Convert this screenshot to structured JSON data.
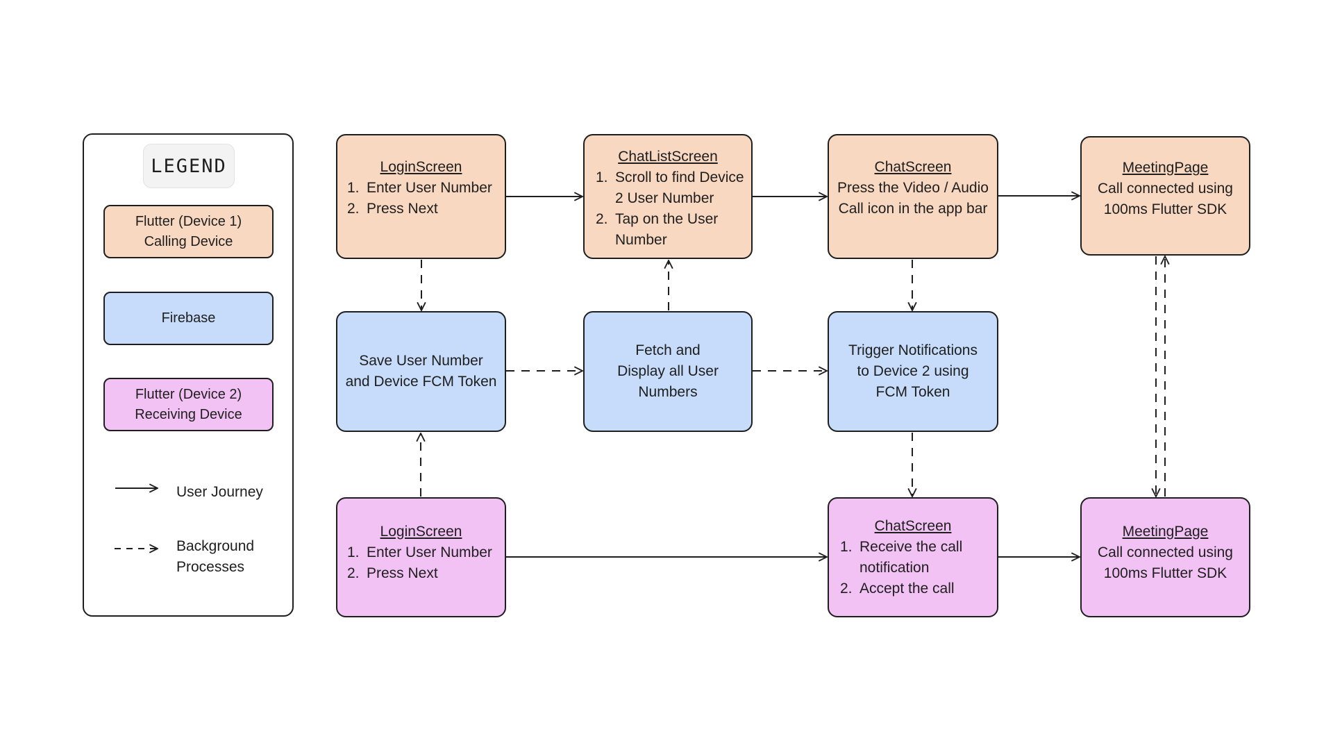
{
  "legend": {
    "title": "LEGEND",
    "items": [
      {
        "line1": "Flutter (Device 1)",
        "line2": "Calling Device",
        "color": "#f8d8c1"
      },
      {
        "line1": "Firebase",
        "line2": "",
        "color": "#c6dcfa"
      },
      {
        "line1": "Flutter (Device 2)",
        "line2": "Receiving Device",
        "color": "#f2c2f4"
      }
    ],
    "lines": [
      {
        "style": "solid",
        "label": "User Journey"
      },
      {
        "style": "dashed",
        "label": "Background\nProcesses"
      }
    ]
  },
  "nodes": {
    "d1_login": {
      "title": "LoginScreen",
      "steps": [
        "Enter User Number",
        "Press Next"
      ]
    },
    "d1_chatlist": {
      "title": "ChatListScreen",
      "steps": [
        "Scroll to find Device 2 User Number",
        "Tap on the User Number"
      ]
    },
    "d1_chat": {
      "title": "ChatScreen",
      "text": "Press the Video / Audio\nCall icon in the app bar"
    },
    "d1_meeting": {
      "title": "MeetingPage",
      "text": "Call connected using\n100ms Flutter SDK"
    },
    "fb_save": {
      "text": "Save User Number\nand Device FCM Token"
    },
    "fb_fetch": {
      "text": "Fetch and\nDisplay all User\nNumbers"
    },
    "fb_trigger": {
      "text": "Trigger Notifications\nto Device 2 using\nFCM Token"
    },
    "d2_login": {
      "title": "LoginScreen",
      "steps": [
        "Enter User Number",
        "Press Next"
      ]
    },
    "d2_chat": {
      "title": "ChatScreen",
      "steps": [
        "Receive the call notification",
        "Accept the call"
      ]
    },
    "d2_meeting": {
      "title": "MeetingPage",
      "text": "Call connected using\n100ms Flutter SDK"
    }
  },
  "edges": [
    {
      "from": "d1_login",
      "to": "d1_chatlist",
      "type": "user-journey"
    },
    {
      "from": "d1_chatlist",
      "to": "d1_chat",
      "type": "user-journey"
    },
    {
      "from": "d1_chat",
      "to": "d1_meeting",
      "type": "user-journey"
    },
    {
      "from": "d1_login",
      "to": "fb_save",
      "type": "background"
    },
    {
      "from": "fb_fetch",
      "to": "d1_chatlist",
      "type": "background"
    },
    {
      "from": "d1_chat",
      "to": "fb_trigger",
      "type": "background"
    },
    {
      "from": "fb_save",
      "to": "fb_fetch",
      "type": "background"
    },
    {
      "from": "fb_fetch",
      "to": "fb_trigger",
      "type": "background"
    },
    {
      "from": "d2_login",
      "to": "fb_save",
      "type": "background"
    },
    {
      "from": "fb_trigger",
      "to": "d2_chat",
      "type": "background"
    },
    {
      "from": "d2_login",
      "to": "d2_chat",
      "type": "user-journey"
    },
    {
      "from": "d2_chat",
      "to": "d2_meeting",
      "type": "user-journey"
    },
    {
      "from": "d1_meeting",
      "to": "d2_meeting",
      "type": "background"
    },
    {
      "from": "d2_meeting",
      "to": "d1_meeting",
      "type": "background"
    }
  ]
}
